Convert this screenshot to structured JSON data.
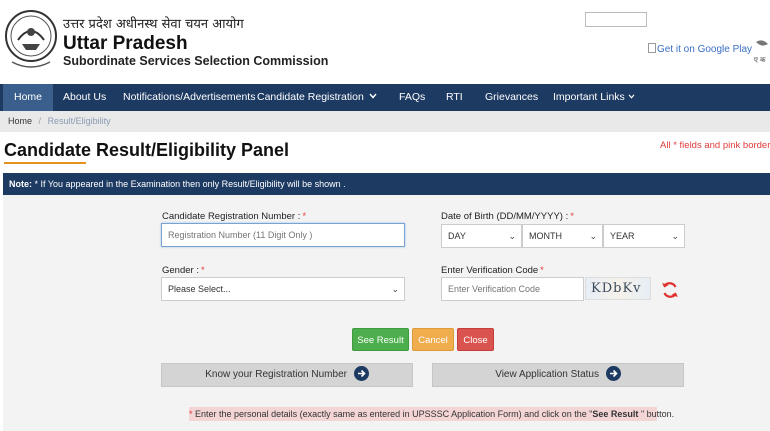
{
  "header": {
    "hindi_title": "उत्तर प्रदेश अधीनस्थ सेवा चयन आयोग",
    "title": "Uttar Pradesh",
    "subtitle": "Subordinate Services Selection Commission",
    "google_play": "Get it on Google Play",
    "edge_logo_text": "ए क"
  },
  "nav": {
    "items": [
      "Home",
      "About Us",
      "Notifications/Advertisements",
      "Candidate Registration",
      "",
      "FAQs",
      "RTI",
      "Grievances",
      "Important Links"
    ],
    "dropdown_icon": "chevron-down-icon",
    "active": "Home"
  },
  "breadcrumb": {
    "home": "Home",
    "separator": "/",
    "current": "Result/Eligibility"
  },
  "page": {
    "title": "Candidate Result/Eligibility Panel",
    "required_note": "All * fields and pink border c",
    "note_label": "Note:",
    "note_text": " * If You appeared in the Examination then only Result/Eligibility will be shown ."
  },
  "form": {
    "reg_label": "Candidate Registration Number :",
    "reg_placeholder": "Registration Number (11 Digit Only )",
    "dob_label": "Date of Birth (DD/MM/YYYY) :",
    "day": "DAY",
    "month": "MONTH",
    "year": "YEAR",
    "gender_label": "Gender :",
    "gender_value": "Please Select...",
    "captcha_label": "Enter Verification Code",
    "captcha_placeholder": "Enter Verification Code",
    "captcha_text": "KDbKv",
    "star": "*"
  },
  "buttons": {
    "see_result": "See Result",
    "cancel": "Cancel",
    "close": "Close",
    "know_reg": "Know your Registration Number",
    "view_status": "View Application Status"
  },
  "instruction": {
    "star": "*",
    "text_before": " Enter the personal details (exactly same as entered in UPSSSC Application Form) and click on the \"",
    "bold": "See Result",
    "text_after": " \" button."
  },
  "colors": {
    "nav": "#1d3a62",
    "green": "#4cae4c",
    "orange": "#f0ad4e",
    "red": "#d9534f"
  }
}
